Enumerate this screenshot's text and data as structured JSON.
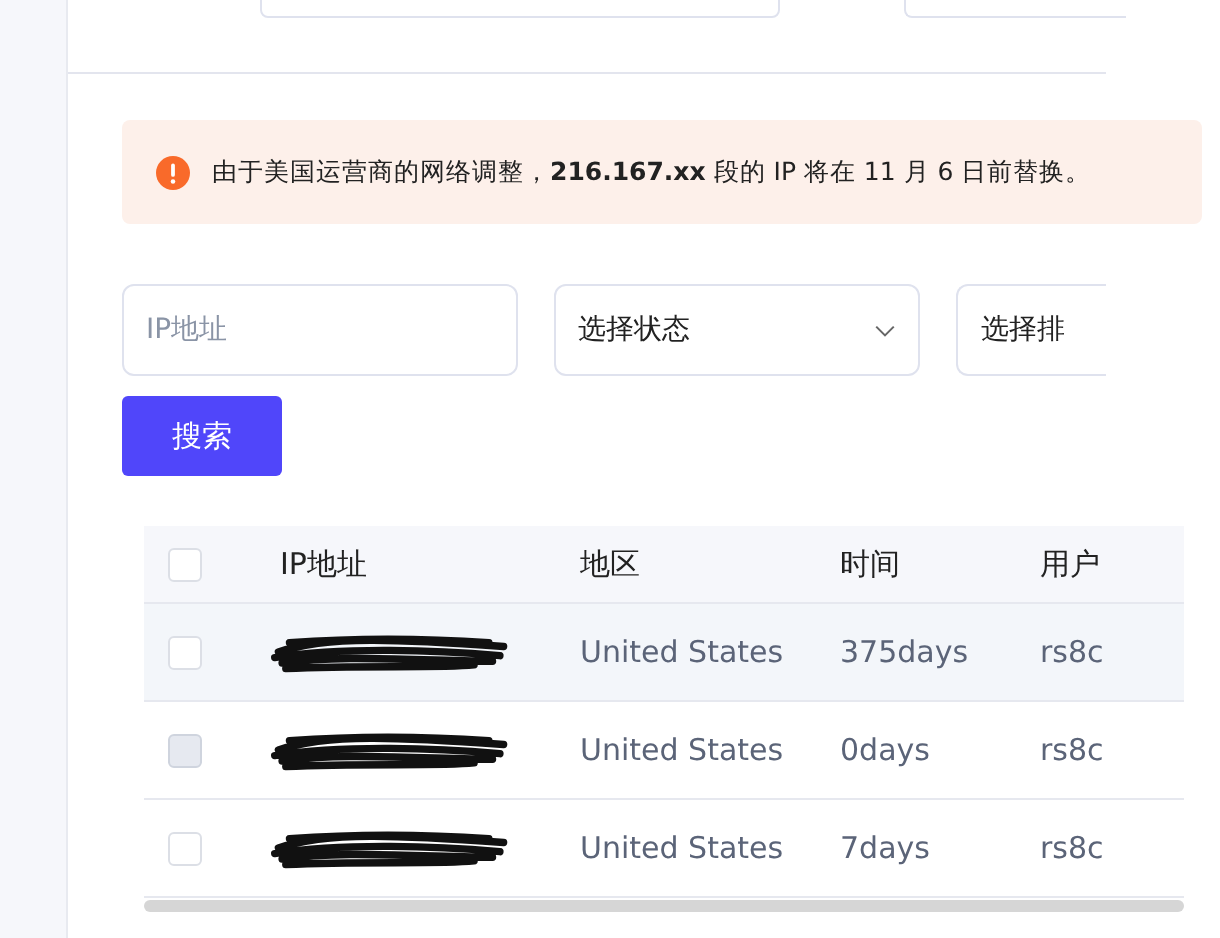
{
  "alert": {
    "kind": "warning",
    "text": "由于美国运营商的网络调整，**216.167.xx** 段的 IP 将在 11 月 6 日前替换。"
  },
  "filters": {
    "ip": {
      "placeholder": "IP地址"
    },
    "status": {
      "value": "选择状态"
    },
    "sort": {
      "value": "选择排"
    }
  },
  "search_button": "搜索",
  "table": {
    "select_all": {
      "checked": false
    },
    "columns": [
      "IP地址",
      "地区",
      "时间",
      "用户"
    ],
    "rows": [
      {
        "selected": true,
        "checked": false,
        "disabled": false,
        "region": "United States",
        "time": "375days",
        "user": "rs8c"
      },
      {
        "selected": false,
        "checked": false,
        "disabled": true,
        "region": "United States",
        "time": "0days",
        "user": "rs8c"
      },
      {
        "selected": false,
        "checked": false,
        "disabled": false,
        "region": "United States",
        "time": "7days",
        "user": "rs8c"
      }
    ]
  }
}
